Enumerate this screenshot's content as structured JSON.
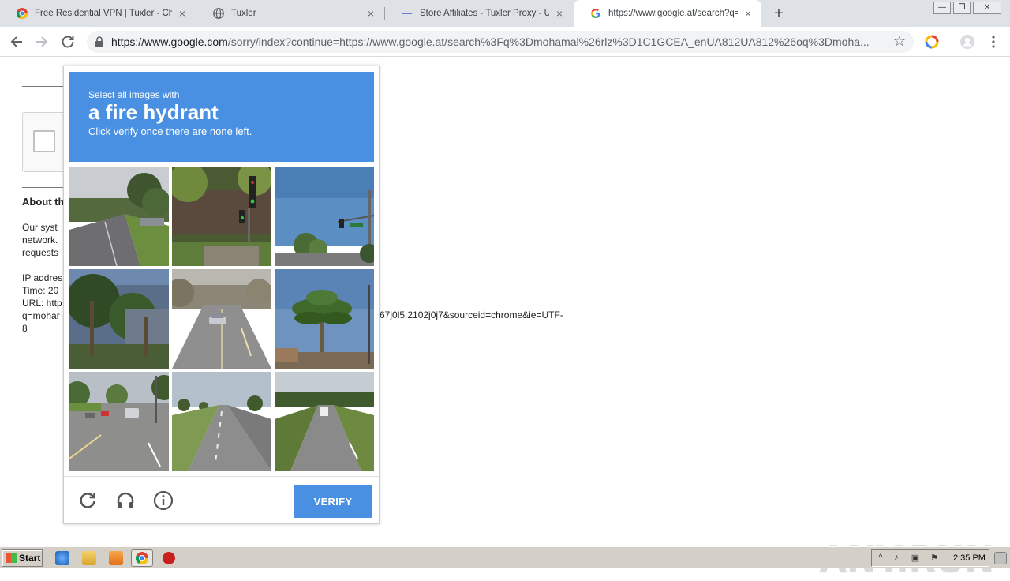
{
  "tabs": [
    {
      "title": "Free Residential VPN | Tuxler - Chrome",
      "icon": "chrome-icon"
    },
    {
      "title": "Tuxler",
      "icon": "globe-icon"
    },
    {
      "title": "Store Affiliates - Tuxler Proxy - Unblo",
      "icon": "store-icon"
    },
    {
      "title": "https://www.google.at/search?q=mo",
      "icon": "google-icon"
    }
  ],
  "window_controls": {
    "minimize": "—",
    "restore": "❐",
    "close": "✕"
  },
  "address_bar": {
    "domain": "https://www.google.com",
    "path": "/sorry/index?continue=https://www.google.at/search%3Fq%3Dmohamal%26rlz%3D1C1GCEA_enUA812UA812%26oq%3Dmoha..."
  },
  "page": {
    "about_heading": "About th",
    "para_lines": [
      "Our syst",
      "network.",
      "requests"
    ],
    "info_lines": [
      "IP addres",
      "Time: 20",
      "URL: http",
      "q=mohar",
      "8"
    ],
    "url_tail": "67j0l5.2102j0j7&sourceid=chrome&ie=UTF-"
  },
  "captcha": {
    "prompt_prefix": "Select all images with",
    "target": "a fire hydrant",
    "prompt_suffix": "Click verify once there are none left.",
    "verify_label": "VERIFY",
    "tiles": [
      "street-road-trees",
      "street-traffic-light-fence",
      "street-traffic-light-sky",
      "palm-trees-house",
      "road-with-car",
      "palm-tree-sky",
      "intersection-cars",
      "divided-road",
      "highway-truck"
    ]
  },
  "watermark": "ANY.RUN",
  "taskbar": {
    "start_label": "Start",
    "clock": "2:35 PM"
  }
}
